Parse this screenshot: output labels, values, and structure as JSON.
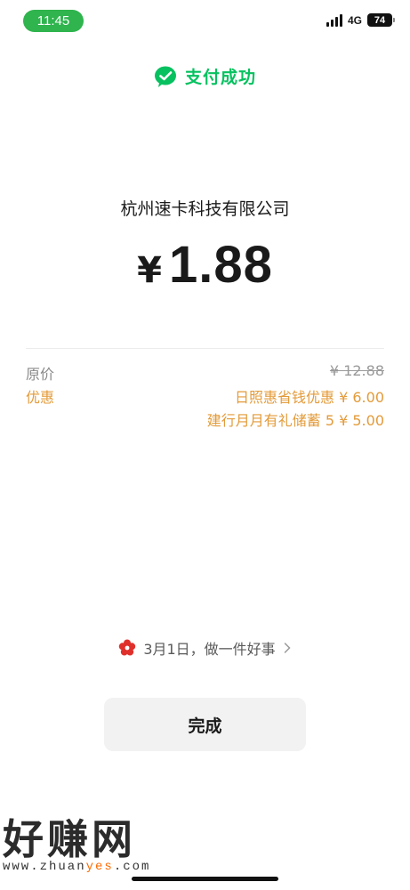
{
  "status_bar": {
    "time": "11:45",
    "network": "4G",
    "battery": "74",
    "accent_color": "#2fb44e"
  },
  "header": {
    "icon": "wechat-pay-icon",
    "title": "支付成功",
    "color": "#07c160"
  },
  "payment": {
    "merchant": "杭州速卡科技有限公司",
    "currency_symbol": "¥",
    "amount": "1.88"
  },
  "details": {
    "original_price_label": "原价",
    "original_price_value": "¥ 12.88",
    "discount_label": "优惠",
    "discounts": [
      "日照惠省钱优惠 ¥ 6.00",
      "建行月月有礼储蓄 5 ¥ 5.00"
    ],
    "discount_color": "#e39b3a"
  },
  "good_deed": {
    "icon": "flower-icon",
    "text": "3月1日，做一件好事",
    "chevron": "chevron-right-icon"
  },
  "done_button": {
    "label": "完成"
  },
  "watermark": {
    "logo": "好赚网",
    "url_prefix": "www.zhuan",
    "url_highlight": "yes",
    "url_suffix": ".com"
  }
}
